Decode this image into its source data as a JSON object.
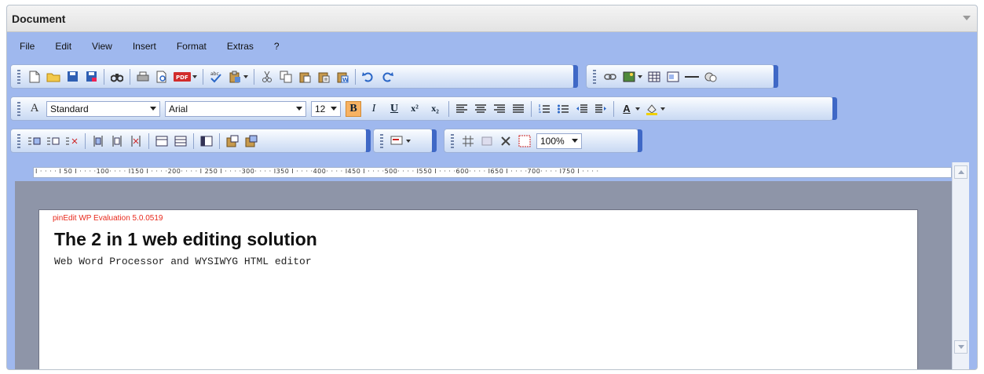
{
  "panel": {
    "title": "Document"
  },
  "menu": {
    "items": [
      "File",
      "Edit",
      "View",
      "Insert",
      "Format",
      "Extras",
      "?"
    ]
  },
  "toolbar": {
    "style_select": "Standard",
    "font_select": "Arial",
    "size_select": "12",
    "zoom_select": "100%",
    "bold_label": "B",
    "italic_label": "I",
    "underline_label": "U",
    "superscript_label": "x²",
    "subscript_label": "x₂",
    "font_color_label": "A",
    "style_glyph": "A"
  },
  "ruler": {
    "text": "I · · · · I 50 I · · · ·100· · · · I150 I · · · ·200· · · · I 250 I · · · ·300· · · · I350 I · · · ·400· · · · I450 I · · · ·500· · · · I550 I · · · ·600· · · · I650 I · · · ·700· · · · I750 I · · · ·"
  },
  "document": {
    "eval_notice": "pinEdit WP Evaluation 5.0.0519",
    "heading": "The 2 in 1 web editing solution",
    "subline": "Web Word Processor and WYSIWYG HTML editor"
  },
  "colors": {
    "accent": "#f7b262",
    "panel_bg": "#9fb8ee",
    "eval_text": "#e8291c",
    "toolbar_end": "#3f68c6"
  }
}
